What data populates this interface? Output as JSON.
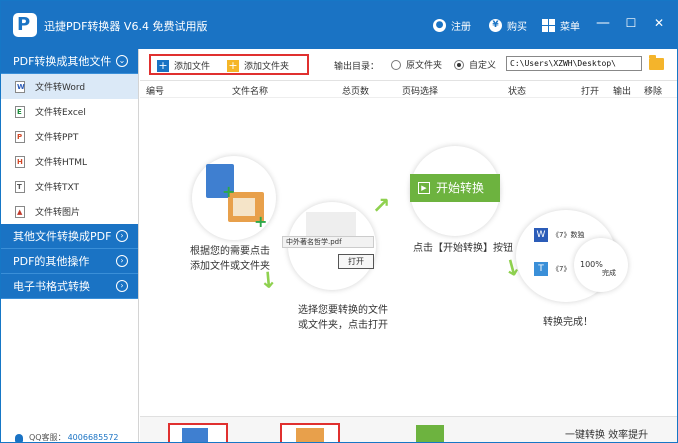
{
  "app": {
    "title": "迅捷PDF转换器 V6.4 免费试用版",
    "logo_letter": "P",
    "register": "注册",
    "buy": "购买",
    "menu": "菜单",
    "minimize": "—",
    "maximize": "☐",
    "close": "✕"
  },
  "sidebar": {
    "categories": [
      {
        "label": "PDF转换成其他文件",
        "chevron": "⌄"
      },
      {
        "label": "其他文件转换成PDF",
        "chevron": "›"
      },
      {
        "label": "PDF的其他操作",
        "chevron": "›"
      },
      {
        "label": "电子书格式转换",
        "chevron": "›"
      }
    ],
    "items": [
      {
        "label": "文件转Word",
        "icon": "W",
        "color": "#2b5cb8"
      },
      {
        "label": "文件转Excel",
        "icon": "E",
        "color": "#1e8c3c"
      },
      {
        "label": "文件转PPT",
        "icon": "P",
        "color": "#d24726"
      },
      {
        "label": "文件转HTML",
        "icon": "H",
        "color": "#d24726"
      },
      {
        "label": "文件转TXT",
        "icon": "T",
        "color": "#555555"
      },
      {
        "label": "文件转图片",
        "icon": "▲",
        "color": "#c0392b"
      }
    ],
    "qq_label": "QQ客服：",
    "qq_number": "4006685572"
  },
  "toolbar": {
    "add_file": "添加文件",
    "add_folder": "添加文件夹",
    "output_label": "输出目录：",
    "radio_original": "原文件夹",
    "radio_custom": "自定义",
    "path": "C:\\Users\\XZWH\\Desktop\\"
  },
  "table": {
    "headers": [
      "编号",
      "文件名称",
      "总页数",
      "页码选择",
      "状态",
      "打开",
      "输出",
      "移除"
    ]
  },
  "guide": {
    "step1": "根据您的需要点击\n添加文件或文件夹",
    "step2": "选择您要转换的文件\n或文件夹，点击打开",
    "step3": "点击【开始转换】按钮",
    "step4": "转换完成！",
    "start_button": "开始转换",
    "open_button": "打开",
    "file_name": "中外著名哲学.pdf",
    "result_name_1": "《7》数独",
    "result_name_2": "《7》",
    "progress": "100%",
    "done": "完成"
  },
  "bottom": {
    "slogan": "一键转换 效率提升"
  },
  "colors": {
    "primary": "#1a73c4",
    "accent_red": "#e0302f",
    "green": "#6db33f"
  }
}
